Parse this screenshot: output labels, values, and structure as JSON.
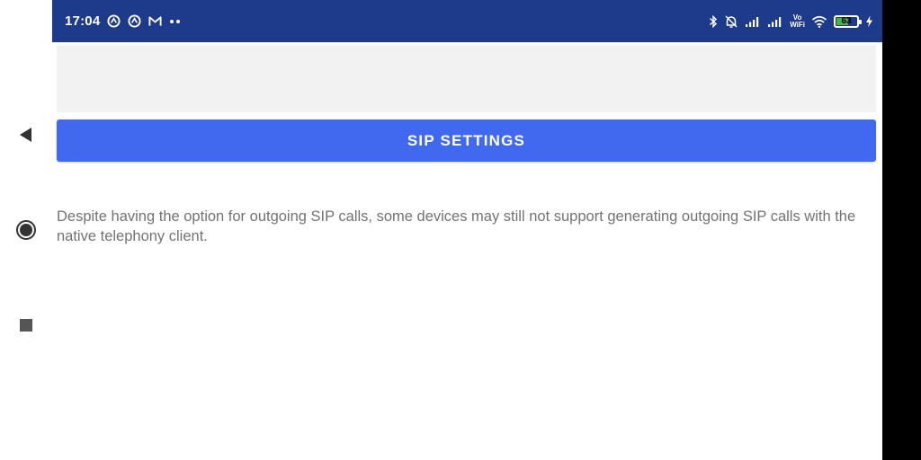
{
  "status_bar": {
    "time": "17:04",
    "left_icons": [
      "notification-a-icon",
      "notification-b-icon",
      "gmail-icon",
      "more-notifications-icon"
    ],
    "right_icons": [
      "bluetooth-icon",
      "alarm-off-icon",
      "signal-1-icon",
      "signal-2-icon",
      "vowifi-icon",
      "wifi-icon",
      "battery-icon",
      "charging-icon"
    ],
    "vowifi_top": "Vo",
    "vowifi_bottom": "WiFi",
    "battery_level": "63",
    "battery_fraction": 0.63,
    "colors": {
      "background": "#1e3a8a",
      "battery_fill": "#4caf50"
    }
  },
  "nav": {
    "icons": [
      "back-icon",
      "home-icon",
      "recents-icon"
    ]
  },
  "main": {
    "button_label": "SIP SETTINGS",
    "note": "Despite having the option for outgoing SIP calls, some devices may still not support generating outgoing SIP calls with the native telephony client.",
    "colors": {
      "button": "#4169f0",
      "panel": "#f2f2f2",
      "note_text": "#737373"
    }
  }
}
